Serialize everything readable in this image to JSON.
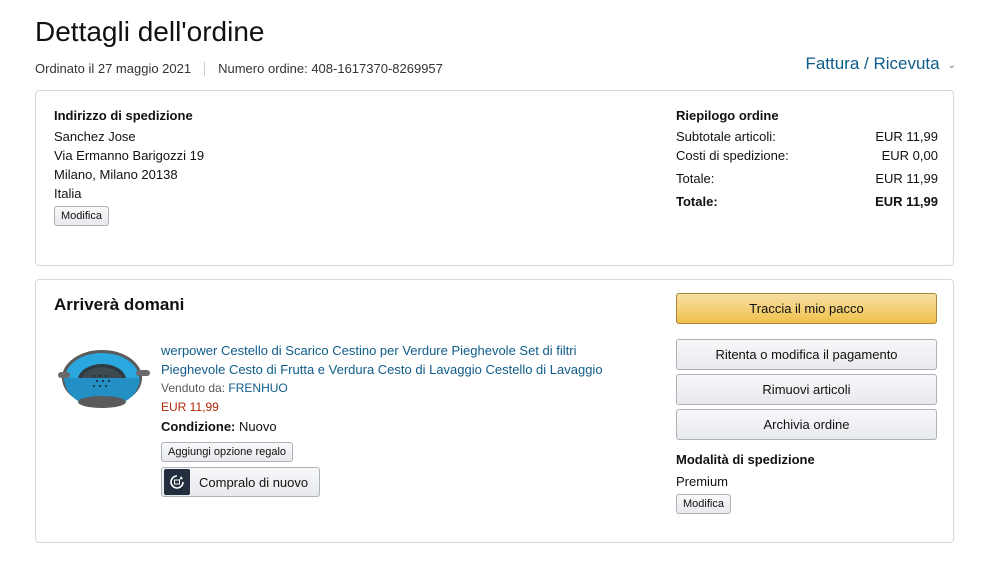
{
  "header": {
    "title": "Dettagli dell'ordine",
    "ordered_on": "Ordinato il 27 maggio 2021",
    "order_number": "Numero ordine: 408-1617370-8269957",
    "invoice_link": "Fattura / Ricevuta"
  },
  "shipping_address": {
    "heading": "Indirizzo di spedizione",
    "lines": [
      "Sanchez Jose",
      "Via Ermanno Barigozzi 19",
      "Milano, Milano 20138",
      "Italia"
    ],
    "edit_label": "Modifica"
  },
  "order_summary": {
    "heading": "Riepilogo ordine",
    "rows": [
      {
        "label": "Subtotale articoli:",
        "value": "EUR 11,99"
      },
      {
        "label": "Costi di spedizione:",
        "value": "EUR 0,00"
      },
      {
        "label": "Totale:",
        "value": "EUR 11,99"
      },
      {
        "label": "Totale:",
        "value": "EUR 11,99"
      }
    ]
  },
  "shipment": {
    "arrival": "Arriverà domani",
    "product": {
      "title": "werpower Cestello di Scarico Cestino per Verdure Pieghevole Set di filtri Pieghevole Cesto di Frutta e Verdura Cesto di Lavaggio Cestello di Lavaggio",
      "sold_by_label": "Venduto da:",
      "seller": "FRENHUO",
      "price": "EUR 11,99",
      "condition_label": "Condizione:",
      "condition_value": "Nuovo",
      "gift_label": "Aggiungi opzione regalo",
      "buy_again_label": "Compralo di nuovo",
      "image_icon": "colander-image"
    },
    "actions": {
      "track": "Traccia il mio pacco",
      "retry_payment": "Ritenta o modifica il pagamento",
      "remove_items": "Rimuovi articoli",
      "archive": "Archivia ordine"
    },
    "shipping_mode": {
      "heading": "Modalità di spedizione",
      "value": "Premium",
      "edit_label": "Modifica"
    }
  },
  "colors": {
    "link": "#0f5c8a",
    "price": "#b12704",
    "primary_button": "#f0c14b",
    "product_blue": "#29a8e0"
  }
}
